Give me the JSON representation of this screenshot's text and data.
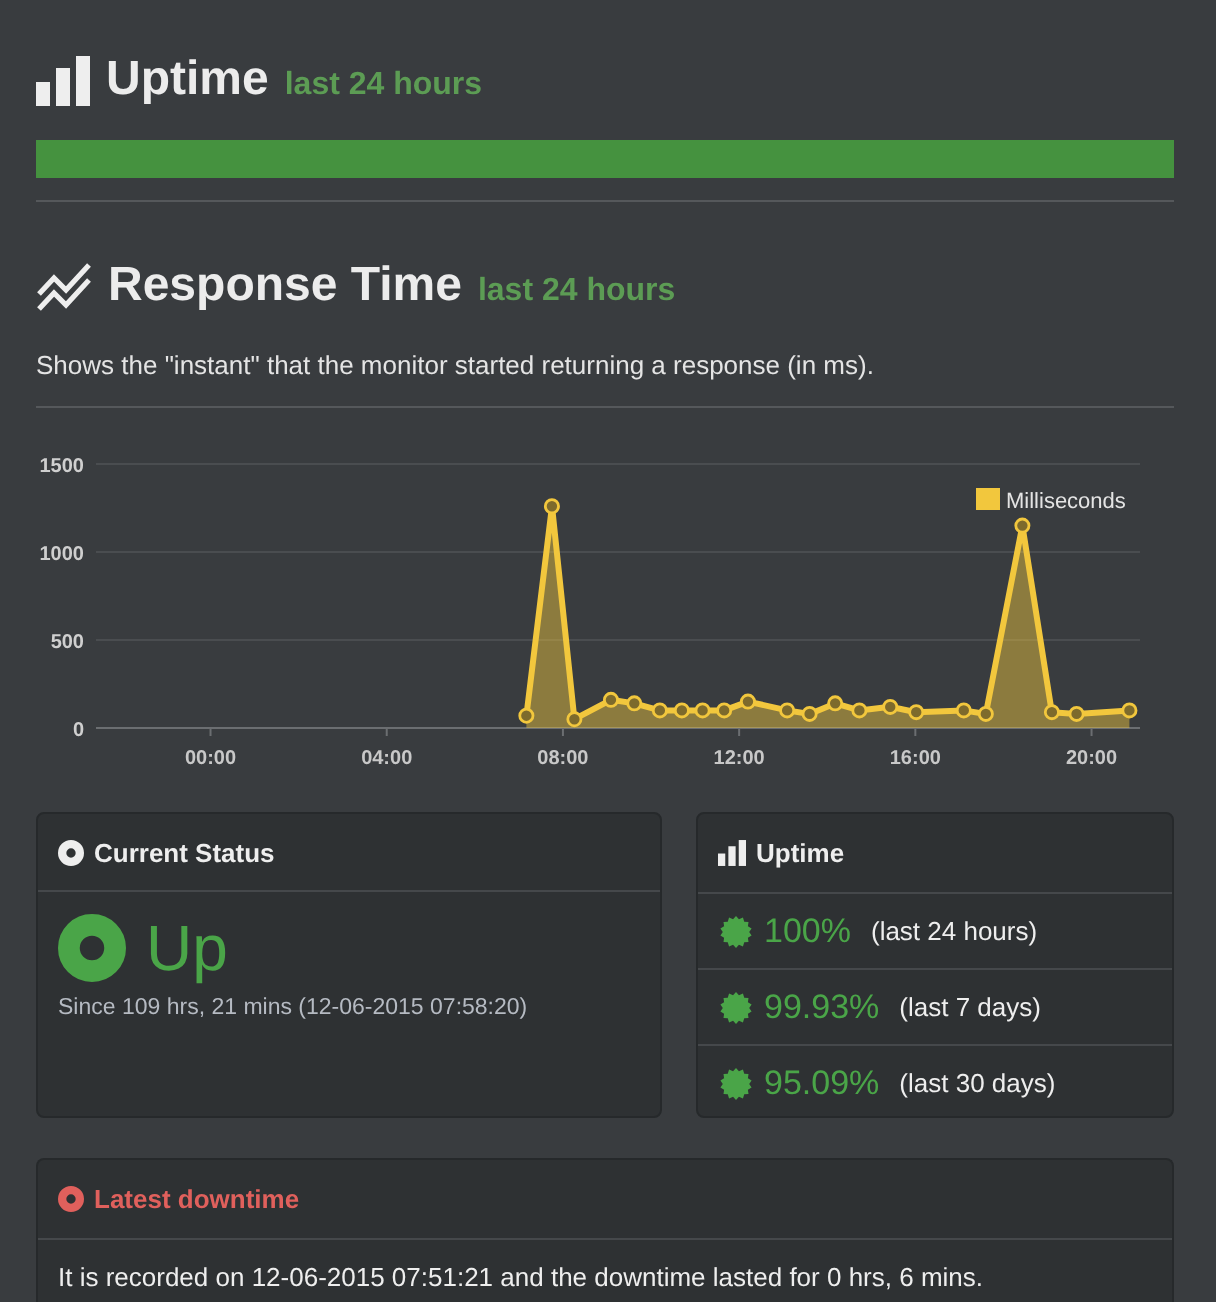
{
  "uptime_section": {
    "title": "Uptime",
    "subtitle": "last 24 hours",
    "bar": {
      "level": 1
    }
  },
  "response_section": {
    "title": "Response Time",
    "subtitle": "last 24 hours",
    "description": "Shows the \"instant\" that the monitor started returning a response (in ms).",
    "chart_data": {
      "type": "area",
      "x": [
        7.17,
        7.75,
        8.26,
        9.09,
        9.62,
        10.2,
        10.7,
        11.17,
        11.66,
        12.2,
        13.09,
        13.6,
        14.18,
        14.73,
        15.43,
        16.02,
        17.1,
        17.6,
        18.43,
        19.1,
        19.66,
        20.86
      ],
      "series": [
        {
          "name": "Milliseconds",
          "color": "#f2c73d",
          "values": [
            70,
            1260,
            50,
            160,
            140,
            100,
            100,
            100,
            100,
            150,
            100,
            80,
            140,
            100,
            120,
            90,
            100,
            80,
            1150,
            90,
            80,
            100
          ]
        }
      ],
      "xlim": [
        -2.6,
        21.1
      ],
      "ylim": [
        0,
        1500
      ],
      "xticks": [
        {
          "value": 0,
          "label": "00:00"
        },
        {
          "value": 4,
          "label": "04:00"
        },
        {
          "value": 8,
          "label": "08:00"
        },
        {
          "value": 12,
          "label": "12:00"
        },
        {
          "value": 16,
          "label": "16:00"
        },
        {
          "value": 20,
          "label": "20:00"
        }
      ],
      "yticks": [
        0,
        500,
        1000,
        1500
      ]
    }
  },
  "current_status": {
    "title": "Current Status",
    "status": "Up",
    "since": "Since 109 hrs, 21 mins (12-06-2015 07:58:20)"
  },
  "uptime_card": {
    "title": "Uptime",
    "rows": [
      {
        "value": "100%",
        "period": "(last 24 hours)"
      },
      {
        "value": "99.93%",
        "period": "(last 7 days)"
      },
      {
        "value": "95.09%",
        "period": "(last 30 days)"
      }
    ]
  },
  "latest_downtime": {
    "title": "Latest downtime",
    "text": "It is recorded on 12-06-2015 07:51:21 and the downtime lasted for 0 hrs, 6 mins."
  }
}
